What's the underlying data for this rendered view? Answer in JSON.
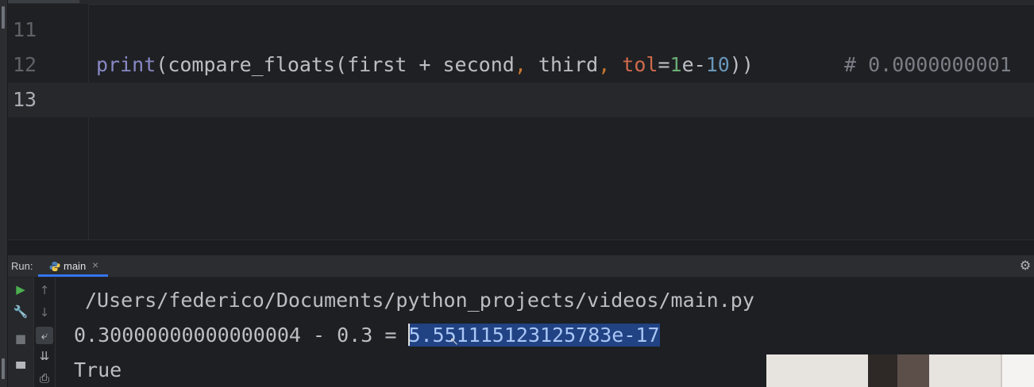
{
  "editor": {
    "lines": [
      {
        "number": "11",
        "code": ""
      },
      {
        "number": "12",
        "tokens": [
          {
            "text": "print",
            "kind": "builtin"
          },
          {
            "text": "(compare_floats(first + second",
            "kind": "plain"
          },
          {
            "text": ", ",
            "kind": "comma"
          },
          {
            "text": "third",
            "kind": "plain"
          },
          {
            "text": ", ",
            "kind": "comma"
          },
          {
            "text": "tol",
            "kind": "kw"
          },
          {
            "text": "=",
            "kind": "plain"
          },
          {
            "text": "1",
            "kind": "num1"
          },
          {
            "text": "e-",
            "kind": "plain"
          },
          {
            "text": "10",
            "kind": "num10"
          },
          {
            "text": "))",
            "kind": "plain"
          }
        ],
        "comment": "# 0.0000000001"
      },
      {
        "number": "13",
        "code": ""
      }
    ],
    "current_line": "13"
  },
  "run_panel": {
    "label": "Run:",
    "tab": {
      "label": "main",
      "icon": "python-icon",
      "close": "×"
    },
    "settings_icon": "gear-icon",
    "toolbar": {
      "left": [
        "run-icon",
        "wrench-icon",
        "stop-icon",
        "layout-icon"
      ],
      "right": [
        "arrow-up-icon",
        "arrow-down-icon",
        "soft-wrap-icon",
        "scroll-to-end-icon",
        "print-icon"
      ]
    },
    "output": {
      "path": "/Users/federico/Documents/python_projects/videos/main.py",
      "line2_prefix": "0.30000000000000004 - 0.3 = ",
      "line2_selected": "5.551115123125783e-17",
      "line3": "True"
    }
  },
  "colors": {
    "background": "#1e1f22",
    "selection": "#214283",
    "accent": "#3574f0",
    "run_green": "#4caf50"
  }
}
